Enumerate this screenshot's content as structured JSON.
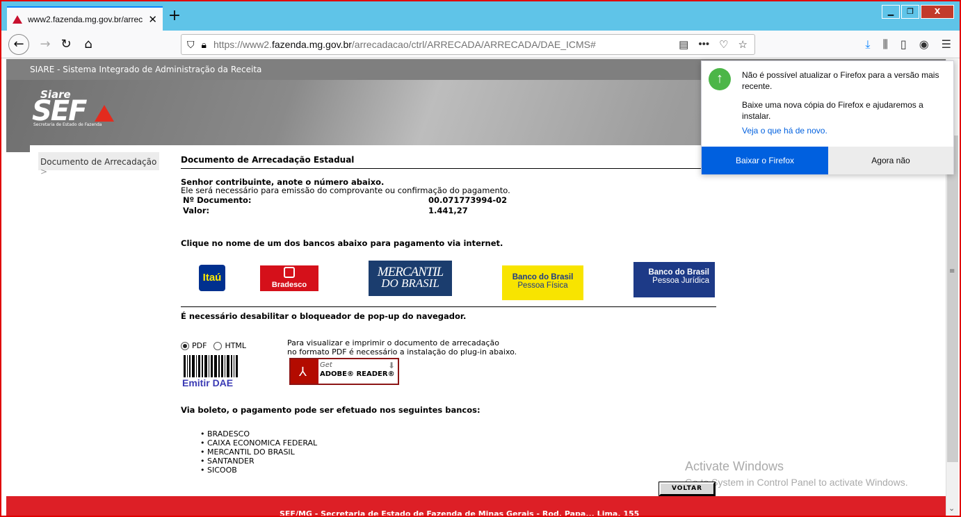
{
  "browser": {
    "tab_title": "www2.fazenda.mg.gov.br/arrec",
    "url_prefix": "https://www2.",
    "url_domain": "fazenda.mg.gov.br",
    "url_path": "/arrecadacao/ctrl/ARRECADA/ARRECADA/DAE_ICMS#"
  },
  "site": {
    "header_title": "SIARE - Sistema Integrado de Administração da Receita",
    "logo_top": "Siare",
    "logo_main": "SEF",
    "logo_sub": "Secretaria de Estado de Fazenda",
    "left_nav_item": "Documento de Arrecadação"
  },
  "doc": {
    "title": "Documento de Arrecadação Estadual",
    "notice_bold": "Senhor contribuinte, anote o número abaixo.",
    "notice": "Ele será necessário para emissão do comprovante ou confirmação do pagamento.",
    "doc_label": "Nº Documento:",
    "doc_value": "00.071773994-02",
    "value_label": "Valor:",
    "value_value": "1.441,27",
    "banks_prompt": "Clique no nome de um dos bancos abaixo para pagamento via internet.",
    "popup_warning": "É necessário desabilitar o bloqueador de pop-up do navegador.",
    "format_pdf": "PDF",
    "format_html": "HTML",
    "emitir_label": "Emitir DAE",
    "pdf_note_1": "Para visualizar e imprimir o documento de arrecadação",
    "pdf_note_2": "no formato PDF é necessário a instalação do plug-in abaixo.",
    "boleto_title": "Via boleto, o pagamento pode ser efetuado nos seguintes bancos:",
    "voltar": "VOLTAR"
  },
  "banks": {
    "itau": "Itaú",
    "bradesco": "Bradesco",
    "mercantil_1": "MERCANTIL",
    "mercantil_2": "DO BRASIL",
    "bbpf_1": "Banco do Brasil",
    "bbpf_2": "Pessoa Física",
    "bbpj_1": "Banco do Brasil",
    "bbpj_2": "Pessoa Jurídica"
  },
  "adobe": {
    "get": "Get",
    "reader": "ADOBE® READER®"
  },
  "boleto_banks": [
    "BRADESCO",
    "CAIXA ECONOMICA FEDERAL",
    "MERCANTIL DO BRASIL",
    "SANTANDER",
    "SICOOB"
  ],
  "footer": "SEF/MG - Secretaria de Estado de Fazenda de Minas Gerais - Rod. Papa... Lima, 155",
  "watermark": {
    "line1": "Activate Windows",
    "line2": "Go to System in Control Panel to activate Windows."
  },
  "update_panel": {
    "message": "Não é possível atualizar o Firefox para a versão mais recente.",
    "message2": "Baixe uma nova cópia do Firefox e ajudaremos a instalar.",
    "link": "Veja o que há de novo.",
    "primary": "Baixar o Firefox",
    "secondary": "Agora não"
  }
}
